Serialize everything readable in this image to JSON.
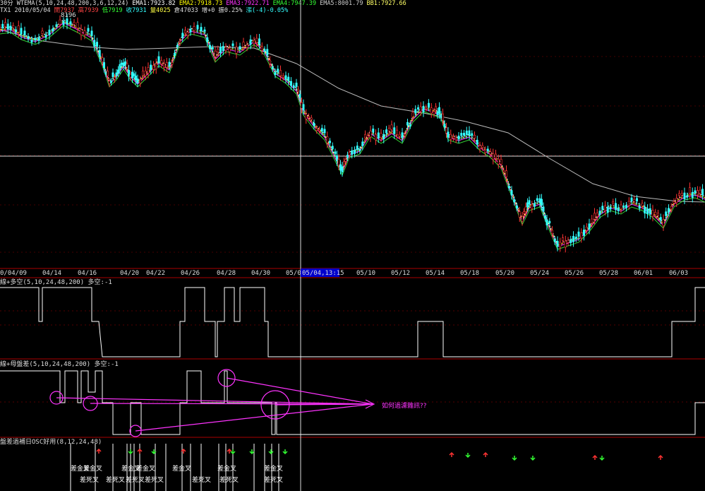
{
  "header": {
    "row1": [
      {
        "text": "30分",
        "color": "#dddddd"
      },
      {
        "text": "WTEMA(5,10,24,48,200,3,6,12,24)",
        "color": "#dddddd"
      },
      {
        "text": "EMA1:7923.82",
        "color": "#ffffff"
      },
      {
        "text": "EMA2:7918.73",
        "color": "#ffff00"
      },
      {
        "text": "EMA3:7922.71",
        "color": "#ff33ff"
      },
      {
        "text": "EMA4:7947.39",
        "color": "#33ff33"
      },
      {
        "text": "EMA5:8001.79",
        "color": "#cccccc"
      },
      {
        "text": "BB1:7927.66",
        "color": "#ffff66"
      }
    ],
    "row2": [
      {
        "text": "TX1  2010/05/04",
        "color": "#dddddd"
      },
      {
        "text": "開7937",
        "color": "#ff4444"
      },
      {
        "text": "高7939",
        "color": "#ff4444"
      },
      {
        "text": "低7919",
        "color": "#33ff33"
      },
      {
        "text": "收7931",
        "color": "#33ffff"
      },
      {
        "text": "量4025",
        "color": "#ffff44"
      },
      {
        "text": "倉47033",
        "color": "#dddddd"
      },
      {
        "text": "增+0",
        "color": "#dddddd"
      },
      {
        "text": "振0.25%",
        "color": "#dddddd"
      },
      {
        "text": "漲(-4)-0.05%",
        "color": "#33ffff"
      }
    ],
    "high_label": "8196"
  },
  "x_axis": {
    "ticks": [
      "0/04/09",
      "04/14",
      "04/16",
      "04/20",
      "04/22",
      "04/26",
      "04/28",
      "04/30",
      "05/0",
      "05/10",
      "05/12",
      "05/14",
      "05/18",
      "05/20",
      "05/24",
      "05/26",
      "05/28",
      "06/01",
      "06/03"
    ],
    "cursor_label": "05/04,13:15"
  },
  "panels": {
    "p2_title": "線+多空(5,10,24,48,200) 多空:-1",
    "p3_title": "線+母盤差(5,10,24,48,200) 多空:-1",
    "p3_annotation": "如何過濾雜訊??",
    "p4_title": "盤差過補日OSC好用(8,12,24,48)"
  },
  "signals": {
    "labels": [
      "差金叉",
      "差死叉"
    ]
  },
  "colors": {
    "candle_up": "#ff3333",
    "candle_down": "#33ffff",
    "ema_white": "#ffffff",
    "ema_yellow": "#ffff00",
    "ema_magenta": "#ff33ff",
    "ema_green": "#33cc33",
    "ema_long": "#bbbbbb",
    "grid": "#aa0000",
    "annotation": "#ff33ff",
    "arrow_up": "#ff3333",
    "arrow_down": "#33ff33"
  },
  "chart_data": {
    "type": "line",
    "title": "TX1",
    "high": 8196,
    "close_at_cursor": 7931,
    "series": [
      {
        "name": "EMA1",
        "values": [
          7923.82
        ]
      },
      {
        "name": "EMA2",
        "values": [
          7918.73
        ]
      },
      {
        "name": "EMA3",
        "values": [
          7922.71
        ]
      },
      {
        "name": "EMA4",
        "values": [
          7947.39
        ]
      },
      {
        "name": "EMA5",
        "values": [
          8001.79
        ]
      },
      {
        "name": "BB1",
        "values": [
          7927.66
        ]
      }
    ]
  }
}
